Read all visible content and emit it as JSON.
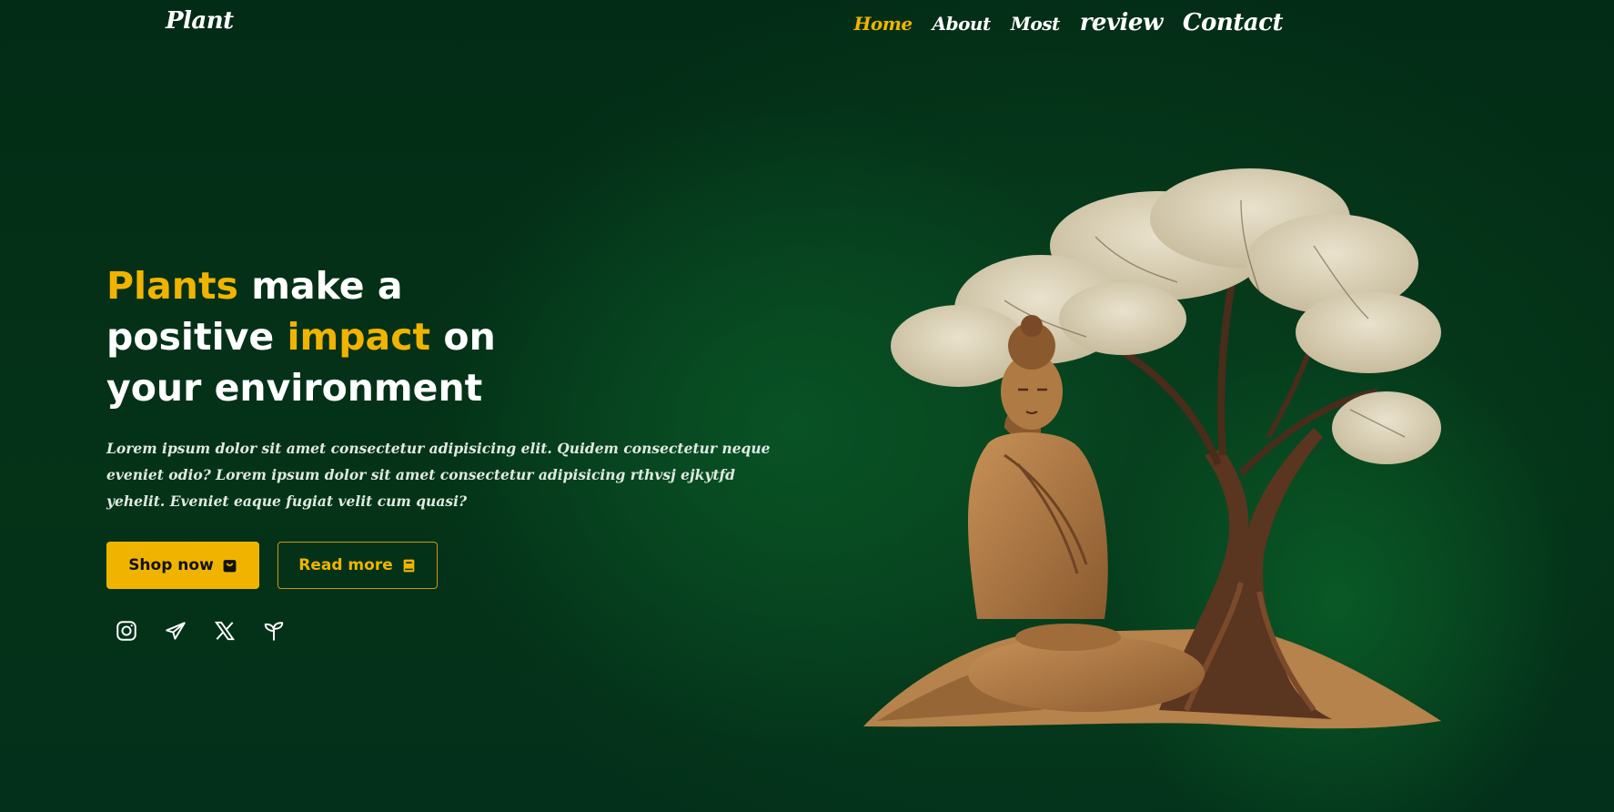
{
  "nav": {
    "logo": "Plant",
    "items": [
      {
        "label": "Home",
        "active": true
      },
      {
        "label": "About"
      },
      {
        "label": "Most"
      },
      {
        "label": "review"
      },
      {
        "label": "Contact"
      }
    ]
  },
  "hero": {
    "headline": {
      "w1": "Plants",
      "w2": " make a",
      "w3": "positive ",
      "w4": "impact",
      "w5": " on",
      "w6": "your environment"
    },
    "description": "Lorem ipsum dolor sit amet consectetur adipisicing elit. Quidem consectetur neque eveniet odio? Lorem ipsum dolor sit amet consectetur adipisicing rthvsj ejkytfd yehelit. Eveniet eaque fugiat velit cum quasi?",
    "buttons": {
      "shop": "Shop now",
      "read": "Read more"
    },
    "social": [
      "instagram-icon",
      "telegram-icon",
      "x-icon",
      "sprout-icon"
    ]
  },
  "colors": {
    "accent": "#f0b400",
    "background": "#032d17",
    "text": "#ffffff"
  }
}
